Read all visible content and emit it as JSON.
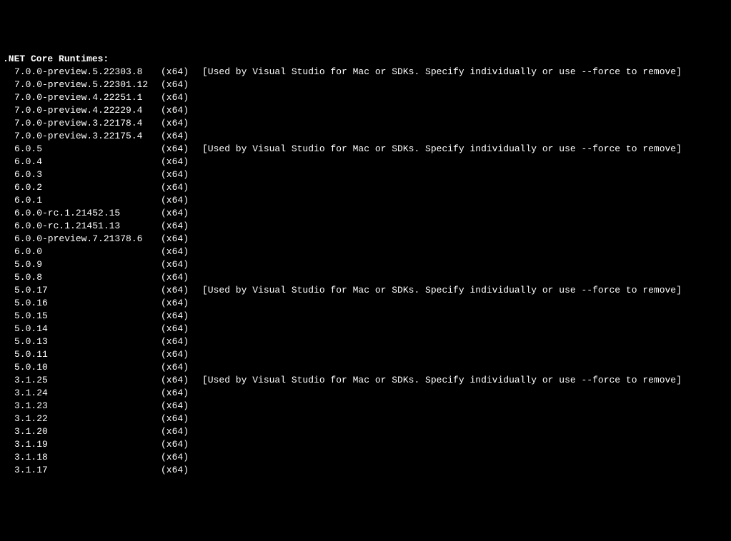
{
  "header": ".NET Core Runtimes:",
  "rows": [
    {
      "version": "7.0.0-preview.5.22303.8",
      "arch": "(x64)",
      "note": "[Used by Visual Studio for Mac or SDKs. Specify individually or use --force to remove]"
    },
    {
      "version": "7.0.0-preview.5.22301.12",
      "arch": "(x64)",
      "note": ""
    },
    {
      "version": "7.0.0-preview.4.22251.1",
      "arch": "(x64)",
      "note": ""
    },
    {
      "version": "7.0.0-preview.4.22229.4",
      "arch": "(x64)",
      "note": ""
    },
    {
      "version": "7.0.0-preview.3.22178.4",
      "arch": "(x64)",
      "note": ""
    },
    {
      "version": "7.0.0-preview.3.22175.4",
      "arch": "(x64)",
      "note": ""
    },
    {
      "version": "6.0.5",
      "arch": "(x64)",
      "note": "[Used by Visual Studio for Mac or SDKs. Specify individually or use --force to remove]"
    },
    {
      "version": "6.0.4",
      "arch": "(x64)",
      "note": ""
    },
    {
      "version": "6.0.3",
      "arch": "(x64)",
      "note": ""
    },
    {
      "version": "6.0.2",
      "arch": "(x64)",
      "note": ""
    },
    {
      "version": "6.0.1",
      "arch": "(x64)",
      "note": ""
    },
    {
      "version": "6.0.0-rc.1.21452.15",
      "arch": "(x64)",
      "note": ""
    },
    {
      "version": "6.0.0-rc.1.21451.13",
      "arch": "(x64)",
      "note": ""
    },
    {
      "version": "6.0.0-preview.7.21378.6",
      "arch": "(x64)",
      "note": ""
    },
    {
      "version": "6.0.0",
      "arch": "(x64)",
      "note": ""
    },
    {
      "version": "5.0.9",
      "arch": "(x64)",
      "note": ""
    },
    {
      "version": "5.0.8",
      "arch": "(x64)",
      "note": ""
    },
    {
      "version": "5.0.17",
      "arch": "(x64)",
      "note": "[Used by Visual Studio for Mac or SDKs. Specify individually or use --force to remove]"
    },
    {
      "version": "5.0.16",
      "arch": "(x64)",
      "note": ""
    },
    {
      "version": "5.0.15",
      "arch": "(x64)",
      "note": ""
    },
    {
      "version": "5.0.14",
      "arch": "(x64)",
      "note": ""
    },
    {
      "version": "5.0.13",
      "arch": "(x64)",
      "note": ""
    },
    {
      "version": "5.0.11",
      "arch": "(x64)",
      "note": ""
    },
    {
      "version": "5.0.10",
      "arch": "(x64)",
      "note": ""
    },
    {
      "version": "3.1.25",
      "arch": "(x64)",
      "note": "[Used by Visual Studio for Mac or SDKs. Specify individually or use --force to remove]"
    },
    {
      "version": "3.1.24",
      "arch": "(x64)",
      "note": ""
    },
    {
      "version": "3.1.23",
      "arch": "(x64)",
      "note": ""
    },
    {
      "version": "3.1.22",
      "arch": "(x64)",
      "note": ""
    },
    {
      "version": "3.1.20",
      "arch": "(x64)",
      "note": ""
    },
    {
      "version": "3.1.19",
      "arch": "(x64)",
      "note": ""
    },
    {
      "version": "3.1.18",
      "arch": "(x64)",
      "note": ""
    },
    {
      "version": "3.1.17",
      "arch": "(x64)",
      "note": ""
    }
  ]
}
